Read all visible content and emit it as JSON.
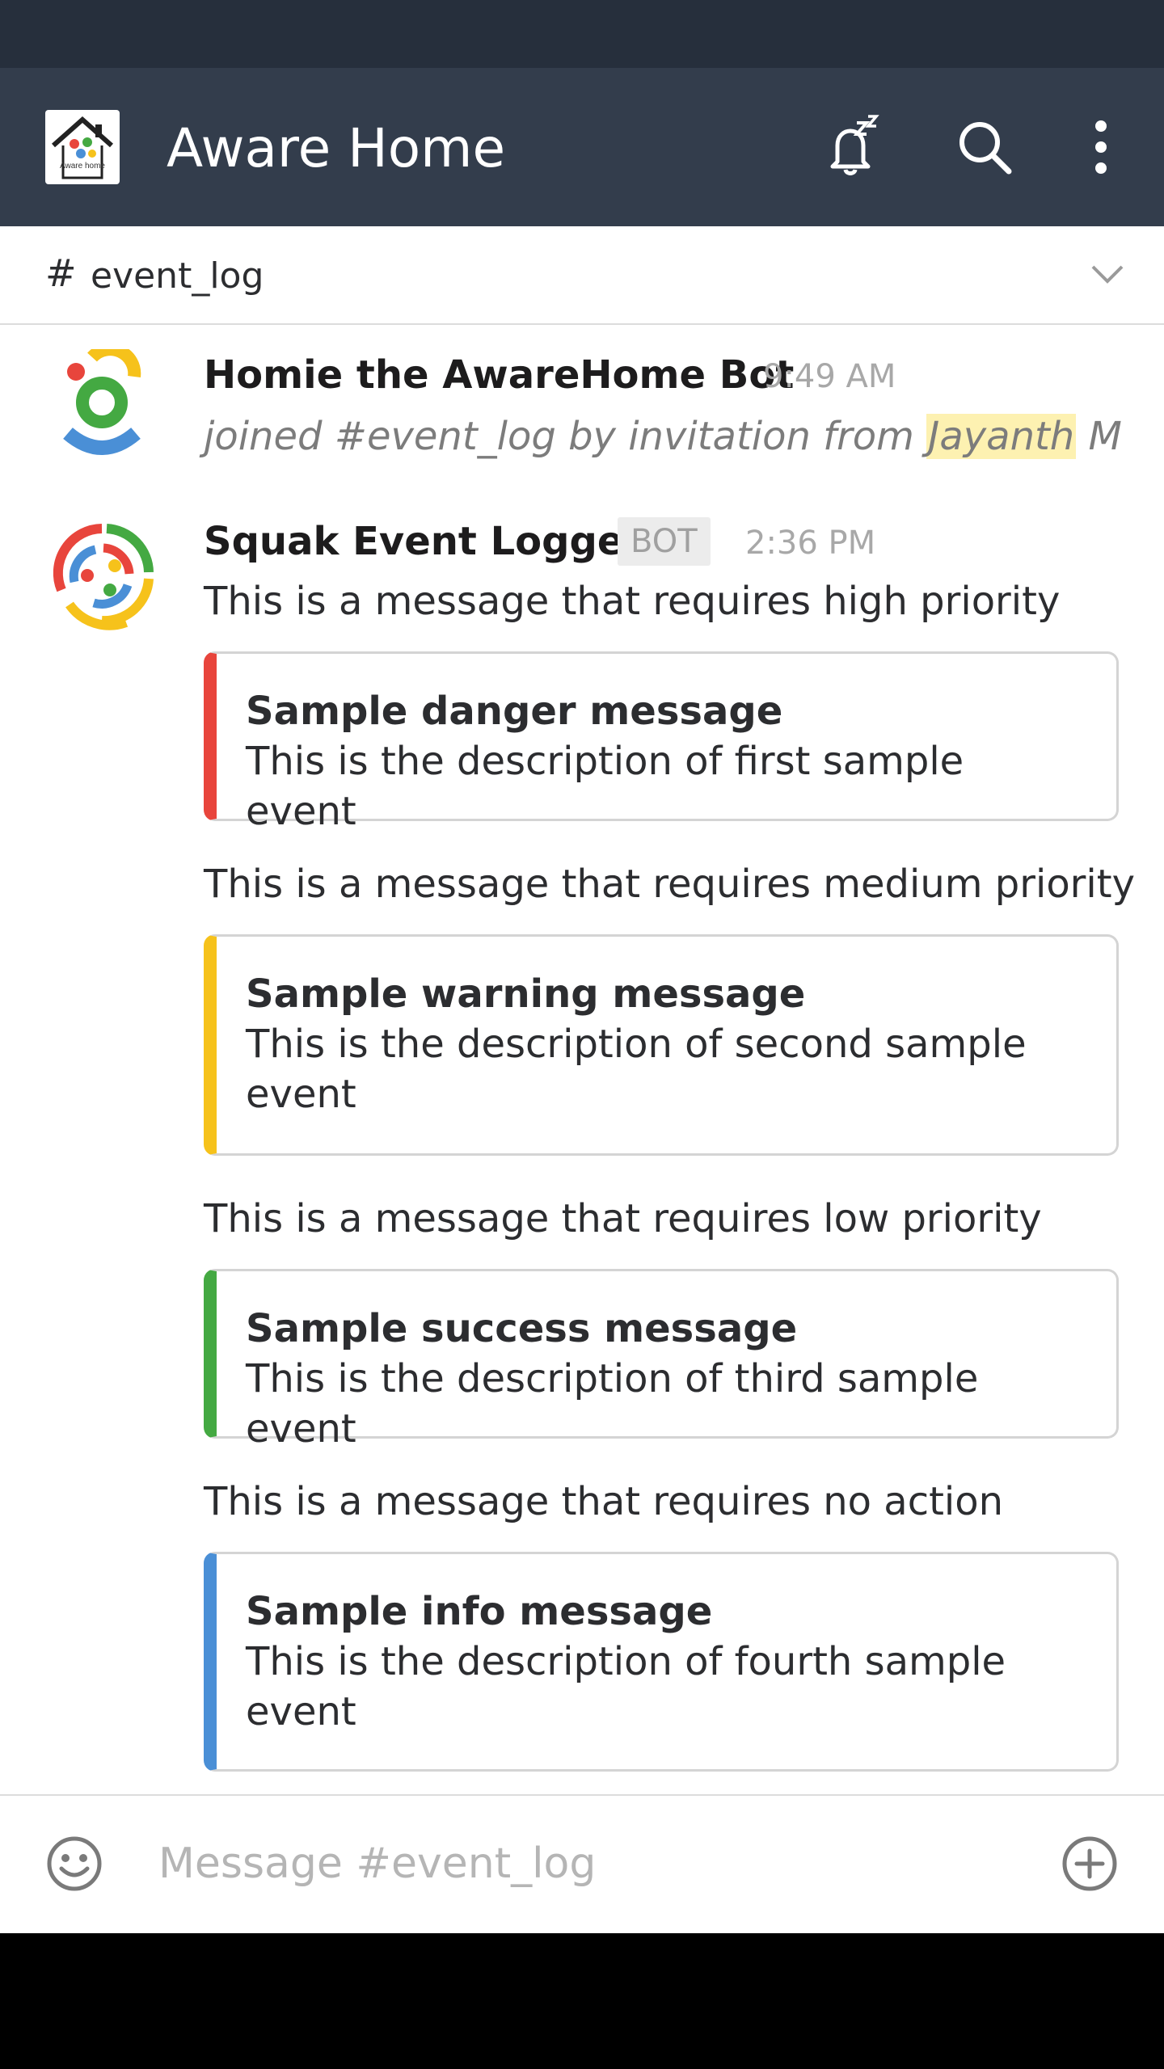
{
  "app": {
    "title": "Aware Home",
    "logo_text": "Aware home"
  },
  "header": {
    "icons": [
      "bell-snooze-icon",
      "search-icon",
      "more-vert-icon"
    ]
  },
  "channel": {
    "hash": "#",
    "name": "event_log"
  },
  "messages": [
    {
      "sender": "Homie the AwareHome Bot",
      "time": "9:49 AM",
      "join_text_before": "joined #event_log by invitation from ",
      "mention": "Jayanth",
      "join_text_after": " M"
    },
    {
      "sender": "Squak Event Logger",
      "badge": "BOT",
      "time": "2:36 PM",
      "blocks": [
        {
          "text": "This is a message that requires high priority",
          "attachment": {
            "title": "Sample danger message",
            "description": "This is the description of first sample event",
            "color": "#e8453c"
          }
        },
        {
          "text": "This is a message that requires medium priority",
          "attachment": {
            "title": "Sample warning message",
            "description": "This is the description of second sample event",
            "color": "#f6c21b"
          }
        },
        {
          "text": "This is a message that requires low priority",
          "attachment": {
            "title": "Sample success message",
            "description": "This is the description of third sample event",
            "color": "#44a942"
          }
        },
        {
          "text": "This is a message that requires no action",
          "attachment": {
            "title": "Sample info message",
            "description": "This is the description of fourth sample event",
            "color": "#4a8fd6"
          }
        }
      ]
    }
  ],
  "composer": {
    "placeholder": "Message #event_log"
  },
  "colors": {
    "status_bar": "#262f3c",
    "app_bar": "#333d4c",
    "mention_highlight": "#fdf1b1"
  }
}
